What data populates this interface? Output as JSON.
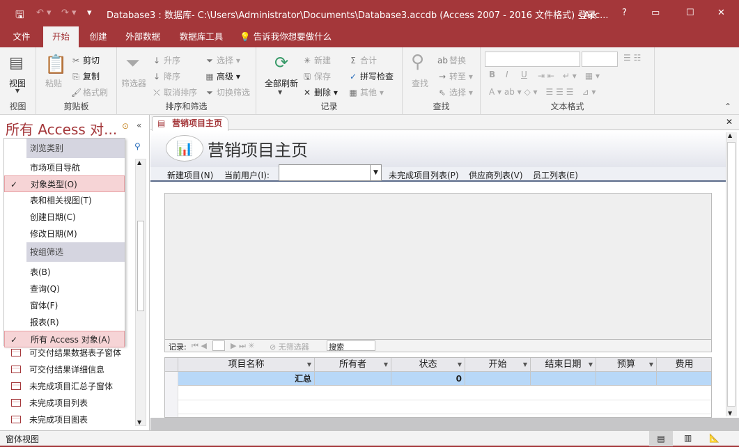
{
  "titlebar": {
    "title": "Database3 : 数据库- C:\\Users\\Administrator\\Documents\\Database3.accdb (Access 2007 - 2016 文件格式)  -  Acc...",
    "login": "登录",
    "help": "?",
    "accent": "#a4373a"
  },
  "ribbon_tabs": [
    {
      "label": "文件"
    },
    {
      "label": "开始"
    },
    {
      "label": "创建"
    },
    {
      "label": "外部数据"
    },
    {
      "label": "数据库工具"
    },
    {
      "label": "告诉我你想要做什么"
    }
  ],
  "ribbon": {
    "view": {
      "button": "视图",
      "label": "视图"
    },
    "clipboard": {
      "paste": "粘贴",
      "cut": "剪切",
      "copy": "复制",
      "format_painter": "格式刷",
      "label": "剪贴板"
    },
    "sort_filter": {
      "filter": "筛选器",
      "asc": "升序",
      "desc": "降序",
      "clear_sort": "取消排序",
      "selection": "选择",
      "advanced": "高级",
      "toggle_filter": "切换筛选",
      "label": "排序和筛选"
    },
    "records": {
      "refresh_all": "全部刷新",
      "new": "新建",
      "save": "保存",
      "delete": "删除",
      "totals": "合计",
      "spelling": "拼写检查",
      "more": "其他",
      "label": "记录"
    },
    "find": {
      "find": "查找",
      "replace": "替换",
      "goto": "转至",
      "select": "选择",
      "label": "查找"
    },
    "text_format": {
      "font": "",
      "size": "",
      "bold": "B",
      "italic": "I",
      "underline": "U",
      "label": "文本格式"
    }
  },
  "nav": {
    "header": "所有 Access 对...",
    "menu": [
      {
        "label": "浏览类别",
        "type": "header"
      },
      {
        "label": "市场项目导航"
      },
      {
        "label": "对象类型(O)",
        "checked": true
      },
      {
        "label": "表和相关视图(T)"
      },
      {
        "label": "创建日期(C)"
      },
      {
        "label": "修改日期(M)"
      },
      {
        "label": "按组筛选",
        "type": "header"
      },
      {
        "label": "表(B)"
      },
      {
        "label": "查询(Q)"
      },
      {
        "label": "窗体(F)"
      },
      {
        "label": "报表(R)"
      },
      {
        "label": "所有 Access 对象(A)",
        "checked": true
      }
    ],
    "items": [
      {
        "label": "可交付结果数据表子窗体"
      },
      {
        "label": "可交付结果详细信息"
      },
      {
        "label": "未完成项目汇总子窗体"
      },
      {
        "label": "未完成项目列表"
      },
      {
        "label": "未完成项目图表"
      }
    ]
  },
  "doc": {
    "tab": "营销项目主页",
    "title": "营销项目主页",
    "links": {
      "new_project": "新建项目(N)",
      "current_user": "当前用户(I):",
      "user_value": "",
      "open_projects": "未完成项目列表(P)",
      "vendors": "供应商列表(V)",
      "employees": "员工列表(E)"
    },
    "recnav": {
      "label": "记录:",
      "no_filter": "无筛选器",
      "search": "搜索"
    },
    "grid": {
      "columns": [
        "项目名称",
        "所有者",
        "状态",
        "开始",
        "结束日期",
        "预算",
        "费用"
      ],
      "totals_row": [
        "汇总",
        "",
        "0",
        "",
        "",
        "",
        ""
      ]
    }
  },
  "status": {
    "text": "窗体视图"
  }
}
